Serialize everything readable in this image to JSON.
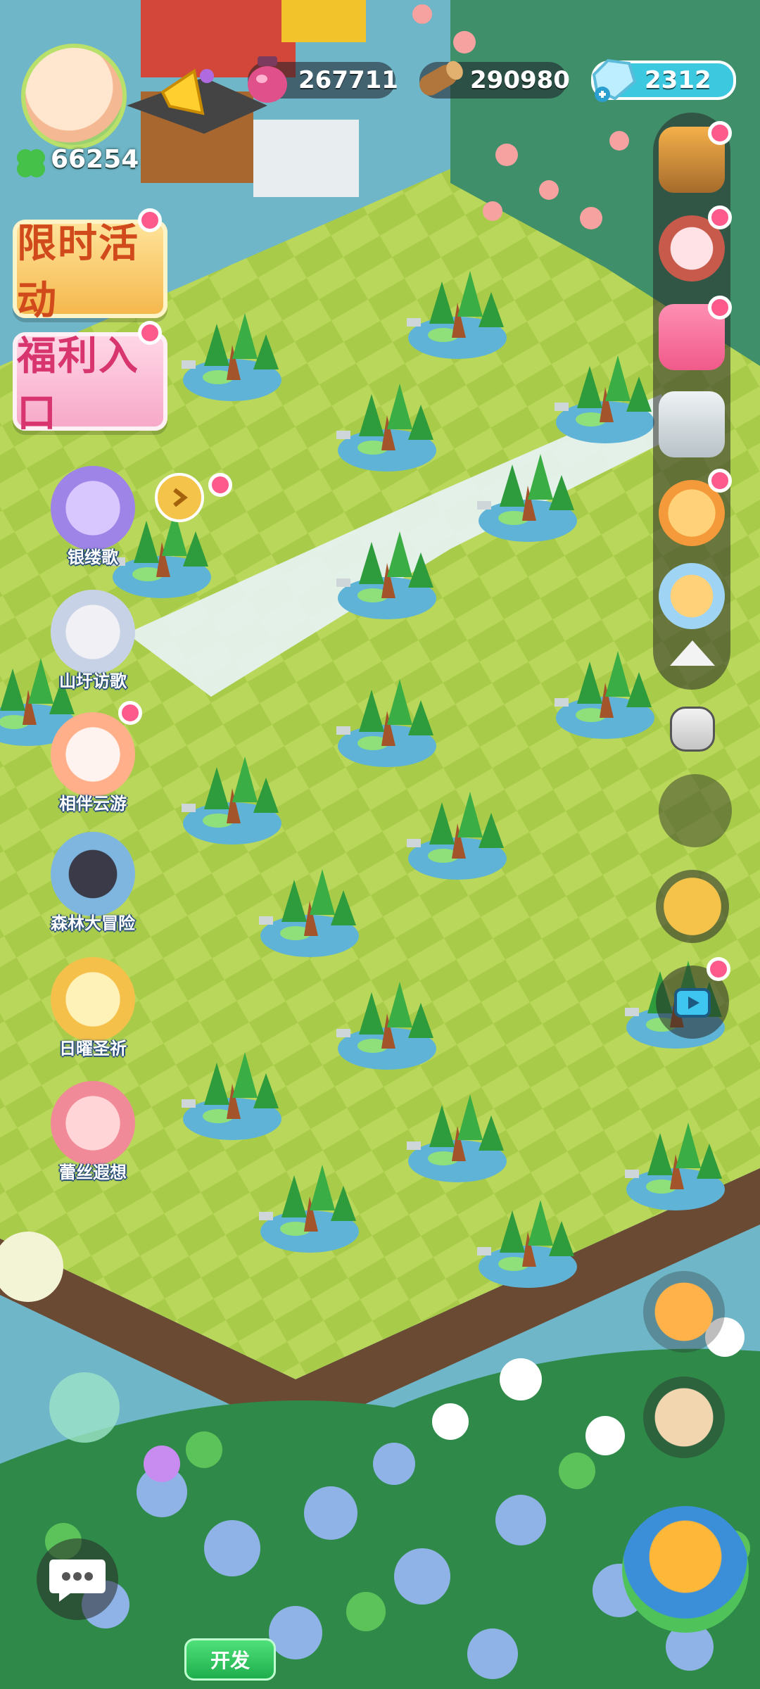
{
  "resources": {
    "potion": "267711",
    "wood": "290980",
    "gems": "2312",
    "clover": "66254"
  },
  "left_menu": {
    "limited_event": "限时活动",
    "welfare": "福利入口"
  },
  "events": [
    {
      "label": "银缕歌"
    },
    {
      "label": "山圩访歌"
    },
    {
      "label": "相伴云游"
    },
    {
      "label": "森林大冒险"
    },
    {
      "label": "日曜圣祈"
    },
    {
      "label": "蕾丝遐想"
    }
  ],
  "bottom": {
    "develop_button": "开发"
  },
  "icons": {
    "potion": "potion-icon",
    "wood": "log-icon",
    "gems": "crystal-icon",
    "clover": "clover-icon",
    "chat": "chat-bubble-icon",
    "collapse": "up-arrow-icon"
  },
  "colors": {
    "grass_light": "#b9d75a",
    "grass_dark": "#8fbf3c",
    "water": "#5fb3d6",
    "badge": "#ff5a8c",
    "gem_pill": "#3cc9e0"
  }
}
